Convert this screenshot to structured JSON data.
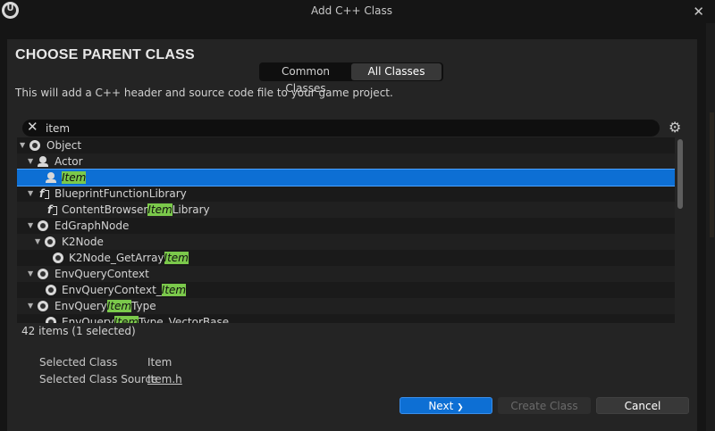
{
  "window": {
    "title": "Add C++ Class",
    "logo": "U",
    "close_icon": "✕"
  },
  "dialog": {
    "heading": "CHOOSE PARENT CLASS",
    "tabs": [
      "Common Classes",
      "All Classes"
    ],
    "selected_tab": "All Classes",
    "description": "This will add a C++ header and source code file to your game project."
  },
  "search": {
    "clear_icon": "✕",
    "value": "item",
    "settings_icon": "⚙"
  },
  "tree": {
    "rows": [
      {
        "pre": "Object",
        "hl": "",
        "post": "",
        "icon": "object",
        "expanded": true,
        "selected": false
      },
      {
        "pre": "Actor",
        "hl": "",
        "post": "",
        "icon": "actor",
        "expanded": true,
        "selected": false
      },
      {
        "pre": "",
        "hl": "Item",
        "post": "",
        "icon": "actor",
        "expanded": false,
        "selected": true
      },
      {
        "pre": "BlueprintFunctionLibrary",
        "hl": "",
        "post": "",
        "icon": "function",
        "expanded": true,
        "selected": false
      },
      {
        "pre": "ContentBrowser",
        "hl": "Item",
        "post": "Library",
        "icon": "function",
        "expanded": false,
        "selected": false
      },
      {
        "pre": "EdGraphNode",
        "hl": "",
        "post": "",
        "icon": "object",
        "expanded": true,
        "selected": false
      },
      {
        "pre": "K2Node",
        "hl": "",
        "post": "",
        "icon": "object",
        "expanded": true,
        "selected": false
      },
      {
        "pre": "K2Node_GetArray",
        "hl": "Item",
        "post": "",
        "icon": "object",
        "expanded": false,
        "selected": false
      },
      {
        "pre": "EnvQueryContext",
        "hl": "",
        "post": "",
        "icon": "object",
        "expanded": true,
        "selected": false
      },
      {
        "pre": "EnvQueryContext_",
        "hl": "Item",
        "post": "",
        "icon": "object",
        "expanded": false,
        "selected": false
      },
      {
        "pre": "EnvQuery",
        "hl": "Item",
        "post": "Type",
        "icon": "object",
        "expanded": true,
        "selected": false
      },
      {
        "pre": "EnvQuery",
        "hl": "Item",
        "post": "Type_VectorBase",
        "icon": "object",
        "expanded": false,
        "selected": false
      }
    ],
    "count_text": "42 items (1 selected)"
  },
  "info": {
    "selected_class_label": "Selected Class",
    "selected_class_value": "Item",
    "selected_class_source_label": "Selected Class Source",
    "selected_class_source_value": "Item.h"
  },
  "buttons": {
    "next": "Next",
    "next_icon": "❯",
    "create": "Create Class",
    "cancel": "Cancel"
  },
  "colors": {
    "accent": "#0d6fd4",
    "highlight": "#7bc94b",
    "background": "#242424"
  }
}
